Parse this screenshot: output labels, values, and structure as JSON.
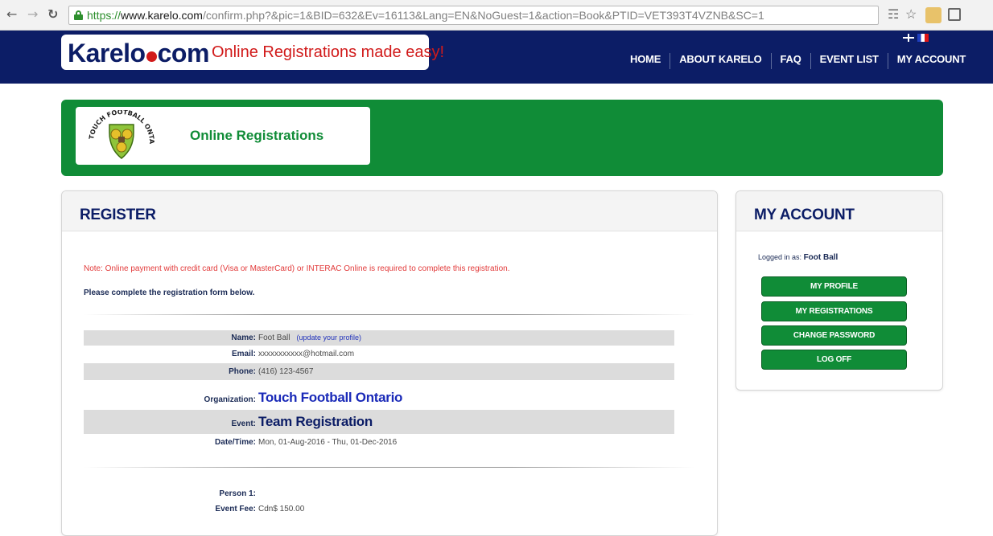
{
  "browser": {
    "url_scheme": "https://",
    "url_host": "www.karelo.com",
    "url_path": "/confirm.php?&pic=1&BID=632&Ev=16113&Lang=EN&NoGuest=1&action=Book&PTID=VET393T4VZNB&SC=1",
    "icons": [
      "back-arrow-icon",
      "forward-arrow-icon",
      "reload-icon",
      "lock-icon",
      "key-icon",
      "star-icon",
      "extension-icon",
      "extension-icon"
    ]
  },
  "header": {
    "logo_part1": "Karelo",
    "logo_part2": "com",
    "tagline": "Online Registrations made easy!",
    "nav": [
      "HOME",
      "ABOUT KARELO",
      "FAQ",
      "EVENT LIST",
      "MY ACCOUNT"
    ]
  },
  "banner": {
    "title": "Online Registrations",
    "logo_text": "TOUCH FOOTBALL ONTARIO"
  },
  "register": {
    "title": "REGISTER",
    "note": "Note: Online payment with credit card (Visa or MasterCard) or INTERAC Online is required to complete this registration.",
    "instructions": "Please complete the registration form below.",
    "profile": {
      "name_label": "Name:",
      "name_value": "Foot Ball",
      "update_link": "(update your profile)",
      "email_label": "Email:",
      "email_value": "xxxxxxxxxxx@hotmail.com",
      "phone_label": "Phone:",
      "phone_value": "(416) 123-4567"
    },
    "event": {
      "org_label": "Organization:",
      "org_value": "Touch Football Ontario",
      "event_label": "Event:",
      "event_value": "Team Registration",
      "date_label": "Date/Time:",
      "date_value": "Mon, 01-Aug-2016 - Thu, 01-Dec-2016"
    },
    "person": {
      "person_label": "Person 1:",
      "fee_label": "Event Fee:",
      "fee_value": "Cdn$ 150.00"
    }
  },
  "account": {
    "title": "MY ACCOUNT",
    "logged_in_prefix": "Logged in as:",
    "logged_in_user": "Foot Ball",
    "buttons": [
      "MY PROFILE",
      "MY REGISTRATIONS",
      "CHANGE PASSWORD",
      "LOG OFF"
    ]
  },
  "colors": {
    "header_bg": "#0c1d66",
    "banner_green": "#108c37",
    "note_red": "#e23a3a",
    "link_blue": "#1a2ab8"
  }
}
